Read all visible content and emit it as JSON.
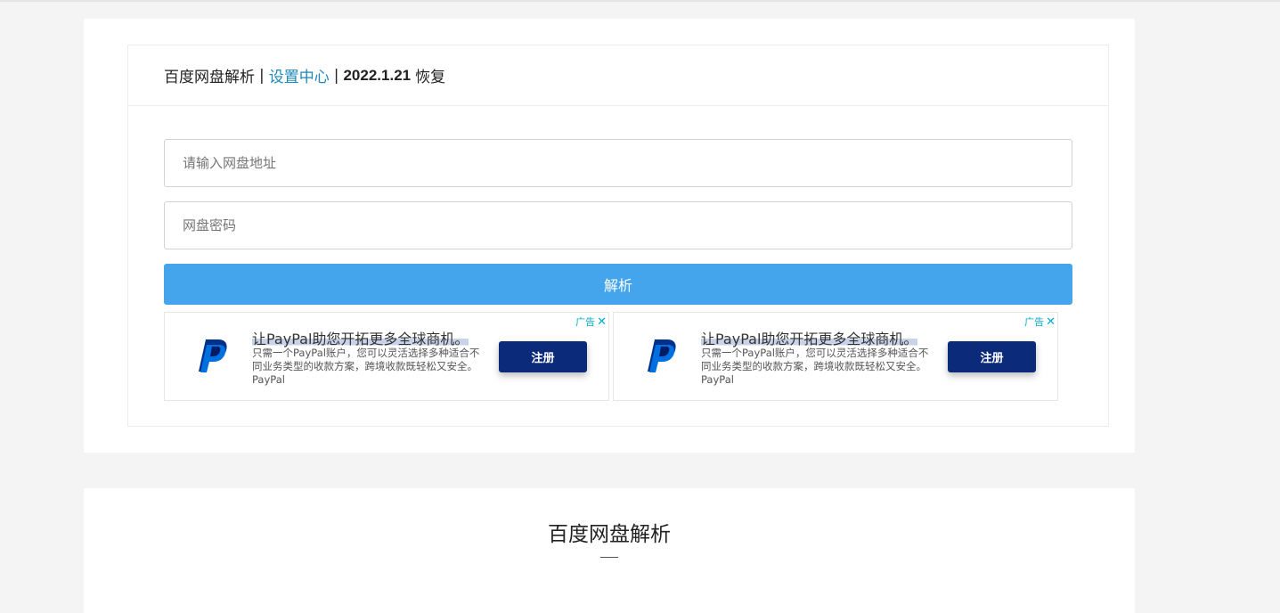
{
  "header": {
    "site_name": "百度网盘解析",
    "separator": "|",
    "settings_link": "设置中心",
    "date": "2022.1.21",
    "status": "恢复"
  },
  "form": {
    "url_placeholder": "请输入网盘地址",
    "password_placeholder": "网盘密码",
    "submit_label": "解析"
  },
  "ads": [
    {
      "choice_label": "广告",
      "close": "✕",
      "title": "让PayPal助您开拓更多全球商机。",
      "description": "只需一个PayPal账户，您可以灵活选择多种适合不同业务类型的收款方案，跨境收款既轻松又安全。 PayPal",
      "button": "注册",
      "logo_icon": "paypal-logo"
    },
    {
      "choice_label": "广告",
      "close": "✕",
      "title": "让PayPal助您开拓更多全球商机。",
      "description": "只需一个PayPal账户，您可以灵活选择多种适合不同业务类型的收款方案，跨境收款既轻松又安全。 PayPal",
      "button": "注册",
      "logo_icon": "paypal-logo"
    }
  ],
  "section": {
    "title": "百度网盘解析"
  },
  "colors": {
    "accent": "#45a5ec",
    "link": "#1e88b8",
    "ad_button": "#0b2a7a",
    "background": "#f4f4f4"
  }
}
